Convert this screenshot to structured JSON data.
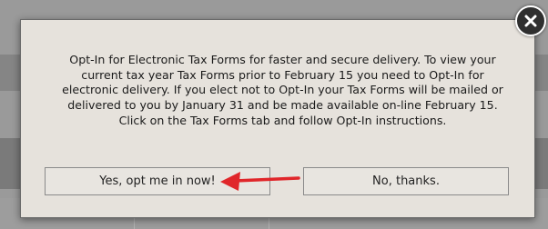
{
  "dialog": {
    "message": "Opt-In for Electronic Tax Forms for faster and secure delivery. To view your current tax year Tax Forms prior to February 15 you need to Opt-In for electronic delivery. If you elect not to Opt-In your Tax Forms will be mailed or delivered to you by January 31 and be made available on-line February 15. Click on the Tax Forms tab and follow Opt-In instructions.",
    "yes_label": "Yes, opt me in now!",
    "no_label": "No, thanks.",
    "close_icon": "close-icon"
  },
  "annotation": {
    "icon": "arrow-left-icon",
    "color": "#e0262a"
  }
}
